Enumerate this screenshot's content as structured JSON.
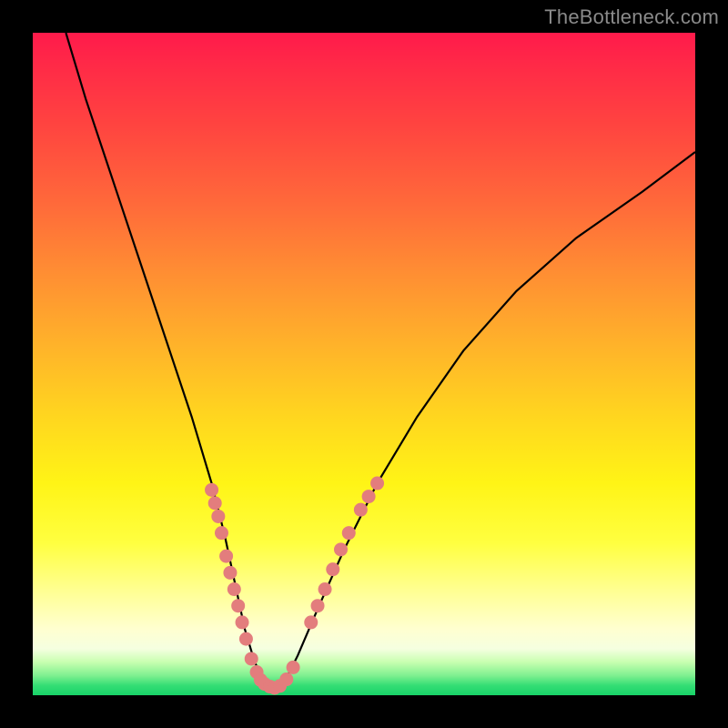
{
  "watermark": {
    "text": "TheBottleneck.com"
  },
  "colors": {
    "frame": "#000000",
    "curve": "#000000",
    "bead": "#e37d7d",
    "gradient_top": "#ff1a4b",
    "gradient_bottom": "#18d268"
  },
  "chart_data": {
    "type": "line",
    "title": "",
    "xlabel": "",
    "ylabel": "",
    "xlim": [
      0,
      100
    ],
    "ylim": [
      0,
      100
    ],
    "series": [
      {
        "name": "bottleneck-curve",
        "x": [
          5,
          8,
          12,
          16,
          20,
          24,
          27,
          29,
          30.5,
          32,
          33.5,
          35,
          36.5,
          38,
          40,
          43,
          47,
          52,
          58,
          65,
          73,
          82,
          92,
          100
        ],
        "y": [
          100,
          90,
          78,
          66,
          54,
          42,
          32,
          24,
          17,
          10,
          5,
          2,
          0.5,
          2,
          6,
          13,
          22,
          32,
          42,
          52,
          61,
          69,
          76,
          82
        ]
      }
    ],
    "bead_clusters": [
      {
        "name": "left-upper",
        "points": [
          {
            "x": 27.0,
            "y": 31
          },
          {
            "x": 27.5,
            "y": 29
          },
          {
            "x": 28.0,
            "y": 27
          },
          {
            "x": 28.5,
            "y": 24.5
          }
        ]
      },
      {
        "name": "left-lower",
        "points": [
          {
            "x": 29.2,
            "y": 21
          },
          {
            "x": 29.8,
            "y": 18.5
          },
          {
            "x": 30.4,
            "y": 16
          },
          {
            "x": 31.0,
            "y": 13.5
          },
          {
            "x": 31.6,
            "y": 11
          },
          {
            "x": 32.2,
            "y": 8.5
          }
        ]
      },
      {
        "name": "bottom",
        "points": [
          {
            "x": 33.0,
            "y": 5.5
          },
          {
            "x": 33.8,
            "y": 3.5
          },
          {
            "x": 34.4,
            "y": 2.3
          },
          {
            "x": 35.0,
            "y": 1.7
          },
          {
            "x": 35.8,
            "y": 1.3
          },
          {
            "x": 36.5,
            "y": 1.1
          },
          {
            "x": 37.3,
            "y": 1.4
          },
          {
            "x": 38.3,
            "y": 2.4
          },
          {
            "x": 39.3,
            "y": 4.2
          }
        ]
      },
      {
        "name": "right-lower",
        "points": [
          {
            "x": 42.0,
            "y": 11
          },
          {
            "x": 43.0,
            "y": 13.5
          },
          {
            "x": 44.1,
            "y": 16
          },
          {
            "x": 45.3,
            "y": 19
          },
          {
            "x": 46.5,
            "y": 22
          },
          {
            "x": 47.7,
            "y": 24.5
          }
        ]
      },
      {
        "name": "right-upper",
        "points": [
          {
            "x": 49.5,
            "y": 28
          },
          {
            "x": 50.7,
            "y": 30
          },
          {
            "x": 52.0,
            "y": 32
          }
        ]
      }
    ]
  }
}
